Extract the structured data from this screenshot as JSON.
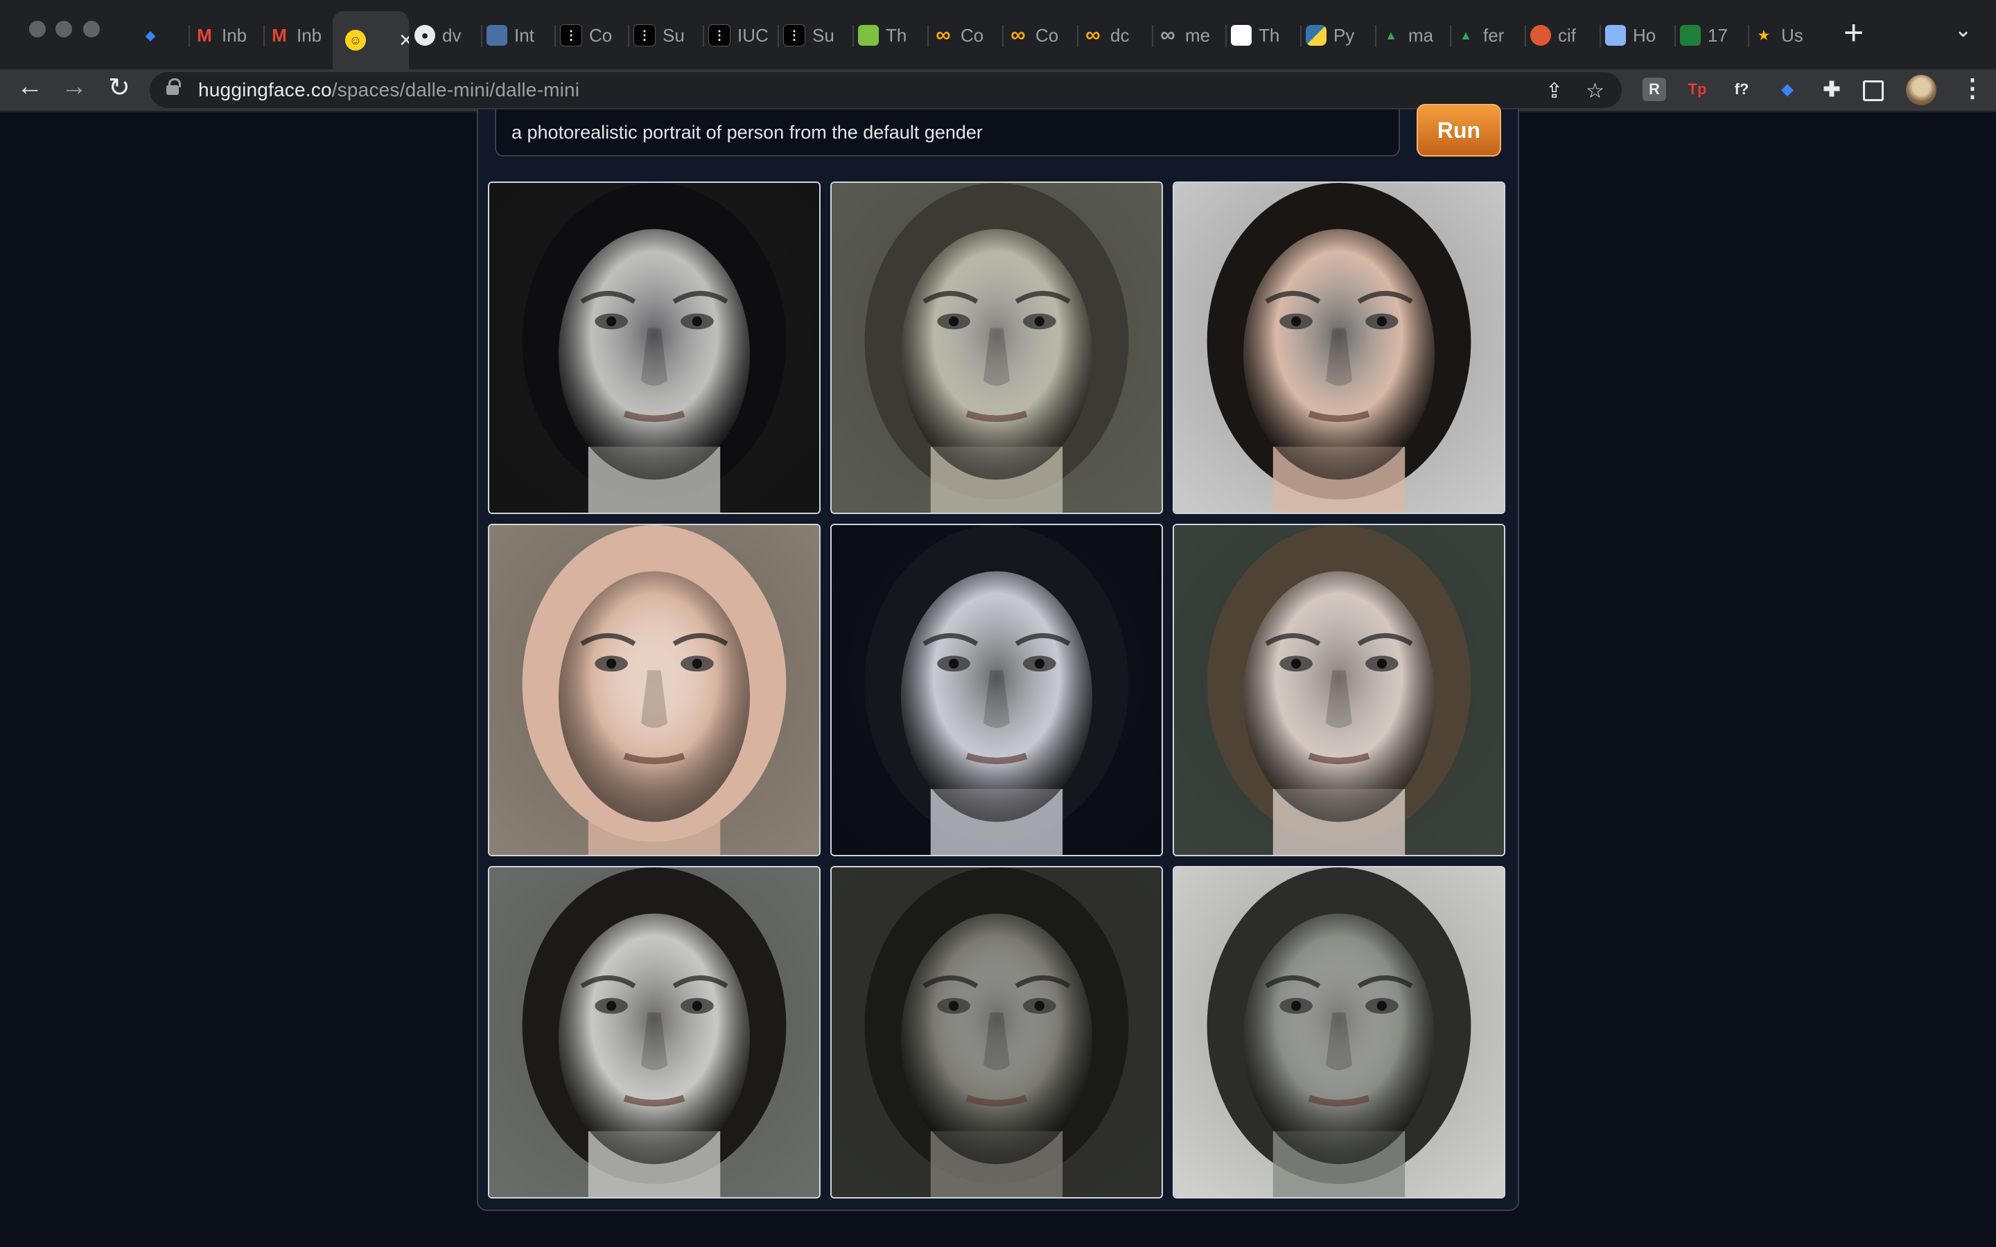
{
  "browser": {
    "tabs": [
      {
        "label": "",
        "favicon": "blue-gem-icon",
        "color": "#3b82f6"
      },
      {
        "label": "Inb",
        "favicon": "gmail-icon",
        "color": "#ea4335"
      },
      {
        "label": "Inb",
        "favicon": "gmail-icon",
        "color": "#ea4335"
      },
      {
        "label": "",
        "favicon": "huggingface-icon",
        "color": "#ffd21e",
        "active": true
      },
      {
        "label": "dv",
        "favicon": "github-icon",
        "color": "#e8eaed"
      },
      {
        "label": "Int",
        "favicon": "tds-icon",
        "color": "#4a6fa5"
      },
      {
        "label": "Co",
        "favicon": "medium-icon",
        "color": "#000000"
      },
      {
        "label": "Su",
        "favicon": "medium-icon",
        "color": "#000000"
      },
      {
        "label": "IUC",
        "favicon": "medium-icon",
        "color": "#000000"
      },
      {
        "label": "Su",
        "favicon": "medium-icon",
        "color": "#000000"
      },
      {
        "label": "Th",
        "favicon": "smiley-icon",
        "color": "#7cc142"
      },
      {
        "label": "Co",
        "favicon": "colab-icon",
        "color": "#f9ab00"
      },
      {
        "label": "Co",
        "favicon": "colab-icon",
        "color": "#f9ab00"
      },
      {
        "label": "dc",
        "favicon": "colab-icon",
        "color": "#f9ab00"
      },
      {
        "label": "me",
        "favicon": "infinity-icon",
        "color": "#9aa0a6"
      },
      {
        "label": "Th",
        "favicon": "qr-icon",
        "color": "#ffffff"
      },
      {
        "label": "Py",
        "favicon": "python-icon",
        "color": "#3776ab"
      },
      {
        "label": "ma",
        "favicon": "drive-icon",
        "color": "#34a853"
      },
      {
        "label": "fer",
        "favicon": "drive-icon",
        "color": "#34a853"
      },
      {
        "label": "cif",
        "favicon": "duckduckgo-icon",
        "color": "#de5833"
      },
      {
        "label": "Ho",
        "favicon": "doc-icon",
        "color": "#8ab4f8"
      },
      {
        "label": "17",
        "favicon": "hp-icon",
        "color": "#1e7f3b"
      },
      {
        "label": "Us",
        "favicon": "star-icon",
        "color": "#fbbc04"
      }
    ],
    "url_host": "huggingface.co",
    "url_path": "/spaces/dalle-mini/dalle-mini",
    "extensions": [
      {
        "name": "readwise-icon",
        "glyph": "R",
        "color": "#9aa0a6"
      },
      {
        "name": "tp-icon",
        "glyph": "Tp",
        "color": "#e53935"
      },
      {
        "name": "function-icon",
        "glyph": "f?",
        "color": "#e8eaed"
      },
      {
        "name": "gem-icon",
        "glyph": "◆",
        "color": "#3b82f6"
      }
    ]
  },
  "app": {
    "prompt_text": "a photorealistic portrait of person from the default gender",
    "run_label": "Run",
    "accent": "#d97a26",
    "images": [
      {
        "tone": "gray",
        "skin": "#bfc0bd",
        "bg": "#141414",
        "hair": "#0e0e12"
      },
      {
        "tone": "sepia",
        "skin": "#b9b7a6",
        "bg": "#5a5b50",
        "hair": "#3d3a33"
      },
      {
        "tone": "warm",
        "skin": "#d9b8a6",
        "bg": "#c9c9c9",
        "hair": "#1a1614"
      },
      {
        "tone": "warm",
        "skin": "#d8b4a0",
        "bg": "#8a7f74",
        "hair": "#d8b4a0"
      },
      {
        "tone": "cool",
        "skin": "#c9c9d3",
        "bg": "#0a0c14",
        "hair": "#15171c"
      },
      {
        "tone": "neutral",
        "skin": "#d4c8c0",
        "bg": "#39413c",
        "hair": "#4e4334"
      },
      {
        "tone": "gray",
        "skin": "#c7c8c4",
        "bg": "#6a6c6a",
        "hair": "#1b1a18"
      },
      {
        "tone": "dark",
        "skin": "#7a7a72",
        "bg": "#2f302b",
        "hair": "#1a1a17"
      },
      {
        "tone": "gray",
        "skin": "#8a8c86",
        "bg": "#cfd0cc",
        "hair": "#2c2d2a"
      }
    ]
  }
}
